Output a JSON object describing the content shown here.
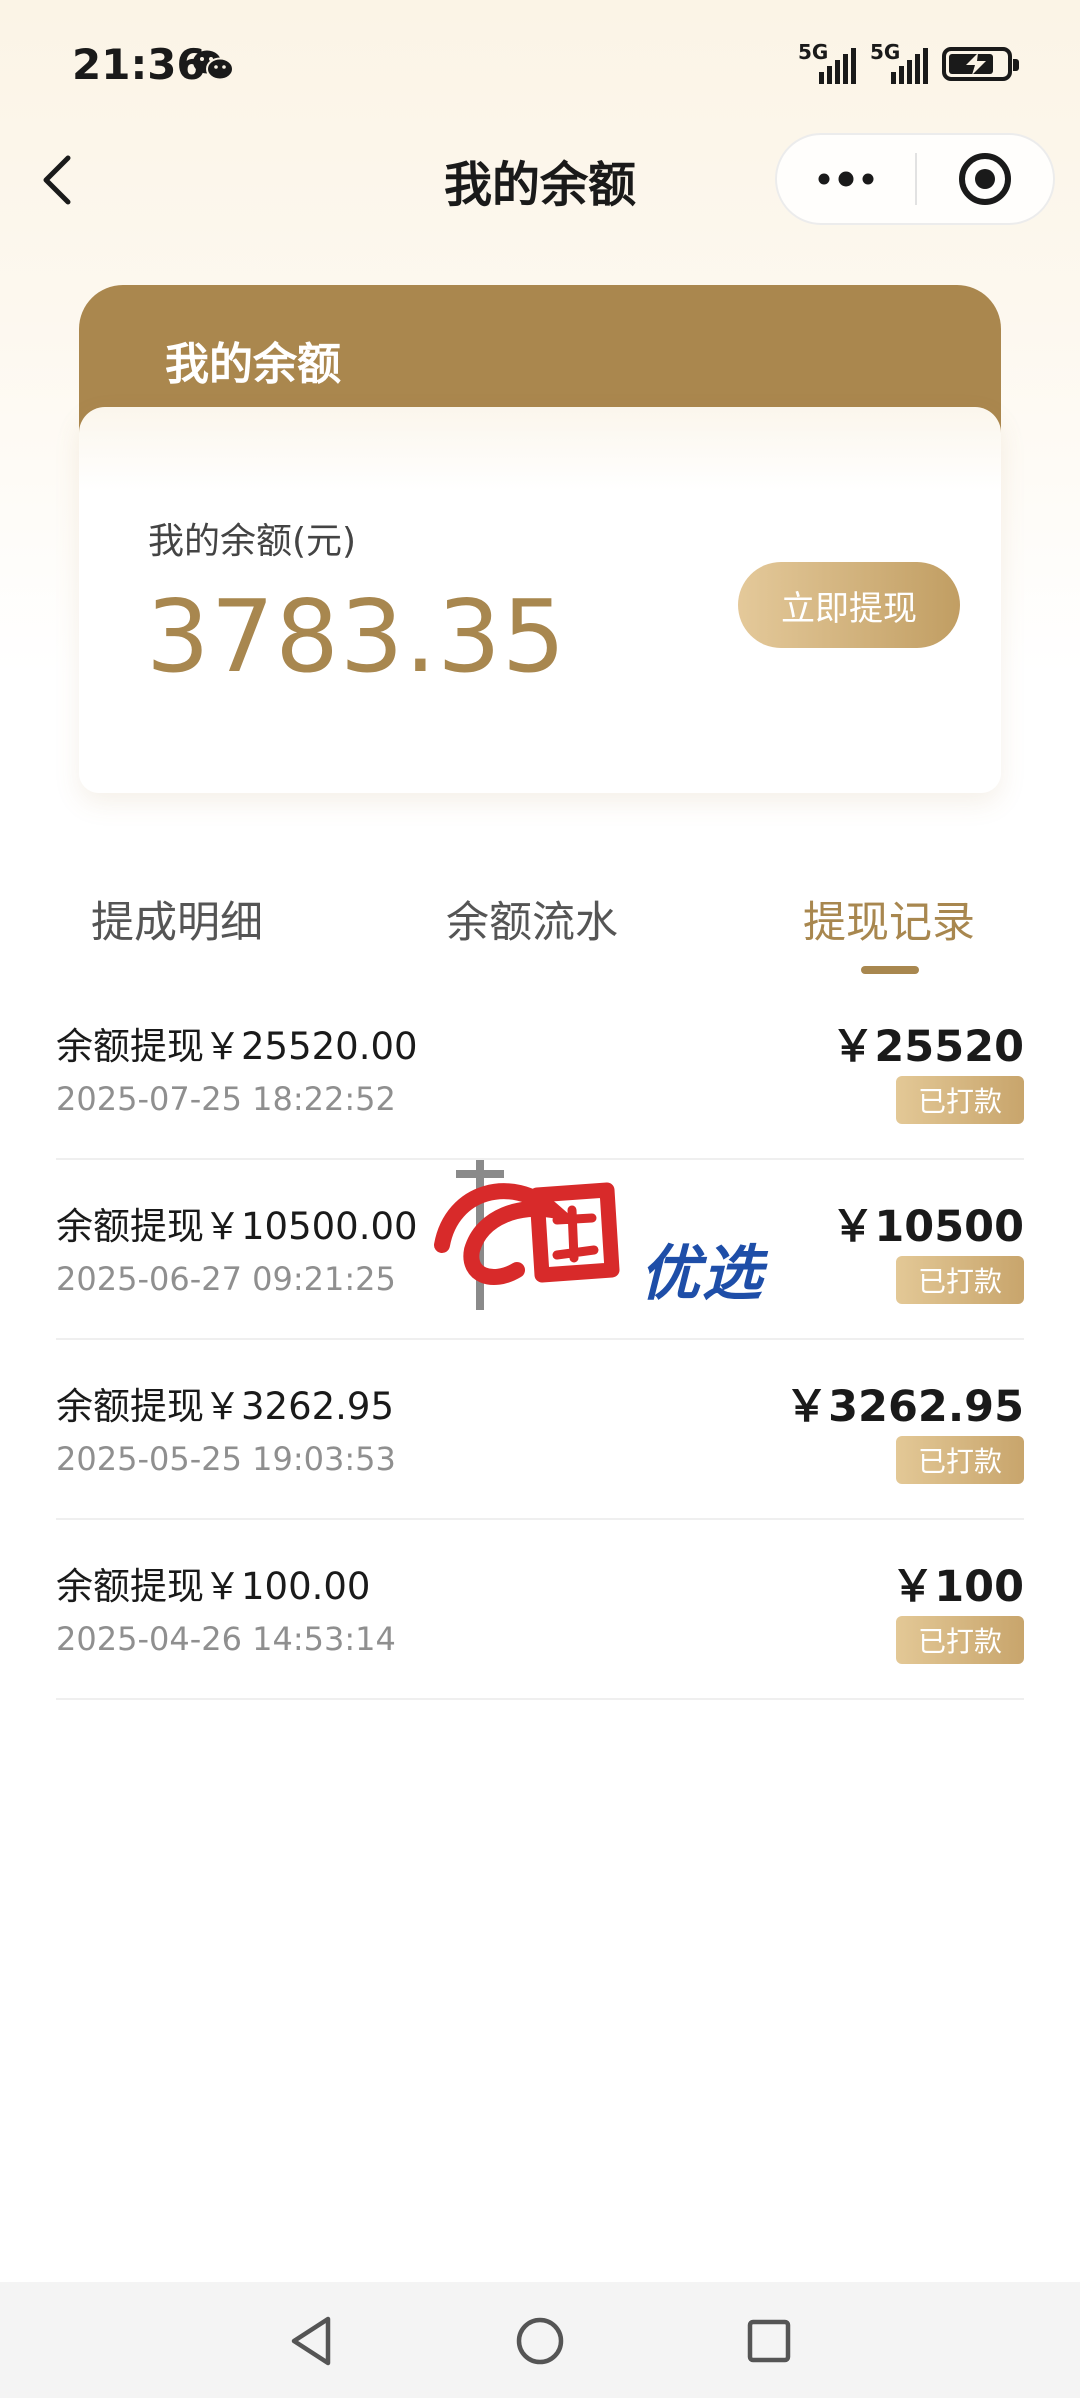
{
  "status_bar": {
    "time": "21:36",
    "network_1": "5G",
    "network_2": "5G",
    "icons": [
      "wechat-icon",
      "signal-icon",
      "signal-icon",
      "battery-charging-icon"
    ]
  },
  "nav": {
    "title": "我的余额",
    "back_icon": "chevron-left-icon",
    "more_icon": "more-dots-icon",
    "close_icon": "target-icon"
  },
  "balance_card": {
    "header_title": "我的余额",
    "label": "我的余额(元)",
    "value": "3783.35",
    "withdraw_label": "立即提现",
    "accent_color": "#aa874e"
  },
  "tabs": [
    {
      "label": "提成明细",
      "active": false
    },
    {
      "label": "余额流水",
      "active": false
    },
    {
      "label": "提现记录",
      "active": true
    }
  ],
  "records": [
    {
      "title": "余额提现￥25520.00",
      "time": "2025-07-25 18:22:52",
      "amount": "￥25520",
      "status": "已打款"
    },
    {
      "title": "余额提现￥10500.00",
      "time": "2025-06-27 09:21:25",
      "amount": "￥10500",
      "status": "已打款"
    },
    {
      "title": "余额提现￥3262.95",
      "time": "2025-05-25 19:03:53",
      "amount": "￥3262.95",
      "status": "已打款"
    },
    {
      "title": "余额提现￥100.00",
      "time": "2025-04-26 14:53:14",
      "amount": "￥100",
      "status": "已打款"
    }
  ],
  "watermark": {
    "text": "优选"
  },
  "system_nav": [
    "back-triangle-icon",
    "home-circle-icon",
    "recents-square-icon"
  ]
}
